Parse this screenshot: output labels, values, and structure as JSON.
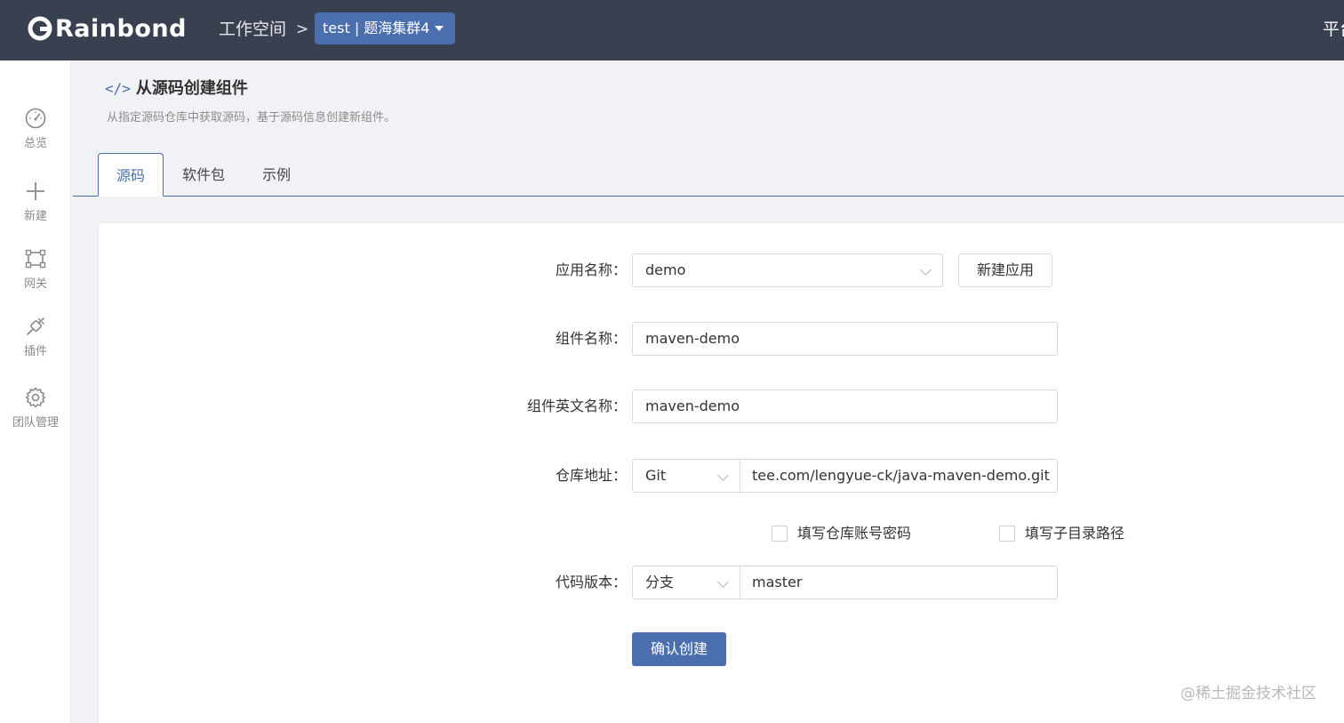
{
  "header": {
    "logo_text": "Rainbond",
    "workspace_label": "工作空间",
    "separator": ">",
    "team_select": "test | 题海集群4",
    "platform_link": "平台管理"
  },
  "sidebar": {
    "items": [
      {
        "label": "总览",
        "icon": "dashboard-icon"
      },
      {
        "label": "新建",
        "icon": "plus-icon"
      },
      {
        "label": "网关",
        "icon": "gateway-icon"
      },
      {
        "label": "插件",
        "icon": "plugin-icon"
      },
      {
        "label": "团队管理",
        "icon": "gear-icon"
      }
    ]
  },
  "page": {
    "title_icon": "</>",
    "title": "从源码创建组件",
    "description": "从指定源码仓库中获取源码，基于源码信息创建新组件。"
  },
  "tabs": [
    {
      "label": "源码",
      "active": true
    },
    {
      "label": "软件包",
      "active": false
    },
    {
      "label": "示例",
      "active": false
    }
  ],
  "form": {
    "app_name": {
      "label": "应用名称：",
      "value": "demo",
      "new_app_button": "新建应用"
    },
    "component_name": {
      "label": "组件名称：",
      "value": "maven-demo"
    },
    "component_en_name": {
      "label": "组件英文名称：",
      "value": "maven-demo"
    },
    "repo": {
      "label": "仓库地址：",
      "type": "Git",
      "url": "tee.com/lengyue-ck/java-maven-demo.git"
    },
    "options": {
      "repo_auth": "填写仓库账号密码",
      "subdir": "填写子目录路径"
    },
    "code_version": {
      "label": "代码版本：",
      "type": "分支",
      "value": "master"
    },
    "submit": "确认创建"
  },
  "watermark": "@稀土掘金技术社区",
  "colors": {
    "header_bg": "#394150",
    "primary": "#4b6fae"
  }
}
